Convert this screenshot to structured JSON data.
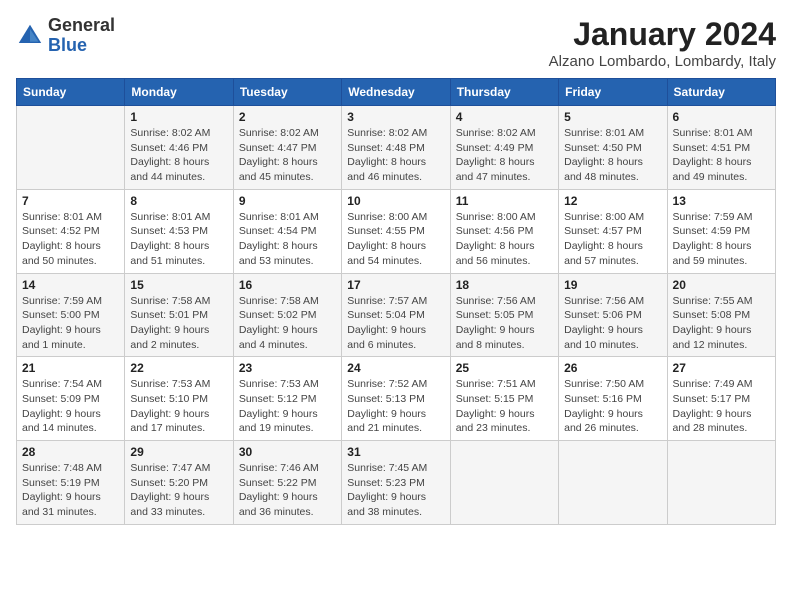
{
  "logo": {
    "general": "General",
    "blue": "Blue"
  },
  "header": {
    "month": "January 2024",
    "location": "Alzano Lombardo, Lombardy, Italy"
  },
  "weekdays": [
    "Sunday",
    "Monday",
    "Tuesday",
    "Wednesday",
    "Thursday",
    "Friday",
    "Saturday"
  ],
  "weeks": [
    [
      {
        "day": "",
        "info": ""
      },
      {
        "day": "1",
        "info": "Sunrise: 8:02 AM\nSunset: 4:46 PM\nDaylight: 8 hours\nand 44 minutes."
      },
      {
        "day": "2",
        "info": "Sunrise: 8:02 AM\nSunset: 4:47 PM\nDaylight: 8 hours\nand 45 minutes."
      },
      {
        "day": "3",
        "info": "Sunrise: 8:02 AM\nSunset: 4:48 PM\nDaylight: 8 hours\nand 46 minutes."
      },
      {
        "day": "4",
        "info": "Sunrise: 8:02 AM\nSunset: 4:49 PM\nDaylight: 8 hours\nand 47 minutes."
      },
      {
        "day": "5",
        "info": "Sunrise: 8:01 AM\nSunset: 4:50 PM\nDaylight: 8 hours\nand 48 minutes."
      },
      {
        "day": "6",
        "info": "Sunrise: 8:01 AM\nSunset: 4:51 PM\nDaylight: 8 hours\nand 49 minutes."
      }
    ],
    [
      {
        "day": "7",
        "info": "Sunrise: 8:01 AM\nSunset: 4:52 PM\nDaylight: 8 hours\nand 50 minutes."
      },
      {
        "day": "8",
        "info": "Sunrise: 8:01 AM\nSunset: 4:53 PM\nDaylight: 8 hours\nand 51 minutes."
      },
      {
        "day": "9",
        "info": "Sunrise: 8:01 AM\nSunset: 4:54 PM\nDaylight: 8 hours\nand 53 minutes."
      },
      {
        "day": "10",
        "info": "Sunrise: 8:00 AM\nSunset: 4:55 PM\nDaylight: 8 hours\nand 54 minutes."
      },
      {
        "day": "11",
        "info": "Sunrise: 8:00 AM\nSunset: 4:56 PM\nDaylight: 8 hours\nand 56 minutes."
      },
      {
        "day": "12",
        "info": "Sunrise: 8:00 AM\nSunset: 4:57 PM\nDaylight: 8 hours\nand 57 minutes."
      },
      {
        "day": "13",
        "info": "Sunrise: 7:59 AM\nSunset: 4:59 PM\nDaylight: 8 hours\nand 59 minutes."
      }
    ],
    [
      {
        "day": "14",
        "info": "Sunrise: 7:59 AM\nSunset: 5:00 PM\nDaylight: 9 hours\nand 1 minute."
      },
      {
        "day": "15",
        "info": "Sunrise: 7:58 AM\nSunset: 5:01 PM\nDaylight: 9 hours\nand 2 minutes."
      },
      {
        "day": "16",
        "info": "Sunrise: 7:58 AM\nSunset: 5:02 PM\nDaylight: 9 hours\nand 4 minutes."
      },
      {
        "day": "17",
        "info": "Sunrise: 7:57 AM\nSunset: 5:04 PM\nDaylight: 9 hours\nand 6 minutes."
      },
      {
        "day": "18",
        "info": "Sunrise: 7:56 AM\nSunset: 5:05 PM\nDaylight: 9 hours\nand 8 minutes."
      },
      {
        "day": "19",
        "info": "Sunrise: 7:56 AM\nSunset: 5:06 PM\nDaylight: 9 hours\nand 10 minutes."
      },
      {
        "day": "20",
        "info": "Sunrise: 7:55 AM\nSunset: 5:08 PM\nDaylight: 9 hours\nand 12 minutes."
      }
    ],
    [
      {
        "day": "21",
        "info": "Sunrise: 7:54 AM\nSunset: 5:09 PM\nDaylight: 9 hours\nand 14 minutes."
      },
      {
        "day": "22",
        "info": "Sunrise: 7:53 AM\nSunset: 5:10 PM\nDaylight: 9 hours\nand 17 minutes."
      },
      {
        "day": "23",
        "info": "Sunrise: 7:53 AM\nSunset: 5:12 PM\nDaylight: 9 hours\nand 19 minutes."
      },
      {
        "day": "24",
        "info": "Sunrise: 7:52 AM\nSunset: 5:13 PM\nDaylight: 9 hours\nand 21 minutes."
      },
      {
        "day": "25",
        "info": "Sunrise: 7:51 AM\nSunset: 5:15 PM\nDaylight: 9 hours\nand 23 minutes."
      },
      {
        "day": "26",
        "info": "Sunrise: 7:50 AM\nSunset: 5:16 PM\nDaylight: 9 hours\nand 26 minutes."
      },
      {
        "day": "27",
        "info": "Sunrise: 7:49 AM\nSunset: 5:17 PM\nDaylight: 9 hours\nand 28 minutes."
      }
    ],
    [
      {
        "day": "28",
        "info": "Sunrise: 7:48 AM\nSunset: 5:19 PM\nDaylight: 9 hours\nand 31 minutes."
      },
      {
        "day": "29",
        "info": "Sunrise: 7:47 AM\nSunset: 5:20 PM\nDaylight: 9 hours\nand 33 minutes."
      },
      {
        "day": "30",
        "info": "Sunrise: 7:46 AM\nSunset: 5:22 PM\nDaylight: 9 hours\nand 36 minutes."
      },
      {
        "day": "31",
        "info": "Sunrise: 7:45 AM\nSunset: 5:23 PM\nDaylight: 9 hours\nand 38 minutes."
      },
      {
        "day": "",
        "info": ""
      },
      {
        "day": "",
        "info": ""
      },
      {
        "day": "",
        "info": ""
      }
    ]
  ]
}
